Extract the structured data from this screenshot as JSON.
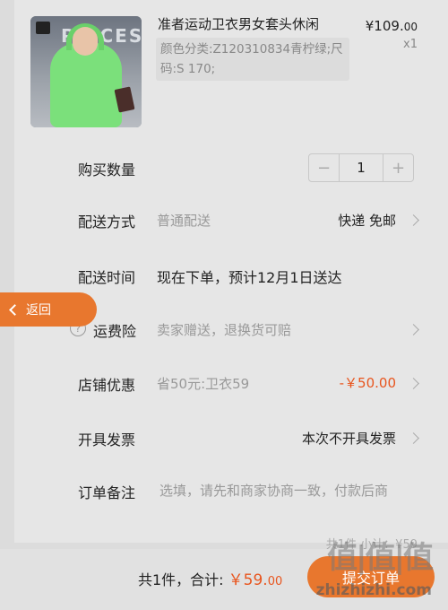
{
  "product": {
    "title": "准者运动卫衣男女套头休闲",
    "variant": "颜色分类:Z120310834青柠绿;尺码:S 170;",
    "price": "¥109.",
    "price_cents": "00",
    "quantity_label": "x1",
    "image_sign_text": "PRICES",
    "image_colors": {
      "hoodie": "#7be07b",
      "background": "#8a8f97"
    }
  },
  "quantity": {
    "label": "购买数量",
    "minus": "−",
    "value": "1",
    "plus": "+"
  },
  "shipping": {
    "label": "配送方式",
    "sub": "普通配送",
    "value": "快递 免邮"
  },
  "delivery_time": {
    "label": "配送时间",
    "value": "现在下单，预计12月1日送达"
  },
  "insurance": {
    "label": "运费险",
    "sub": "卖家赠送，退换货可赔",
    "help_icon": "?"
  },
  "shop_discount": {
    "label": "店铺优惠",
    "sub": "省50元:卫衣59",
    "value": "-￥50.00"
  },
  "invoice": {
    "label": "开具发票",
    "value": "本次不开具发票"
  },
  "note": {
    "label": "订单备注",
    "placeholder": "选填，请先和商家协商一致，付款后商"
  },
  "back_button": {
    "label": "返回"
  },
  "subtotal_ghost": "共1件  小计：¥59",
  "bottom": {
    "count_text": "共1件，合计:",
    "amount": "￥59.",
    "amount_cents": "00",
    "submit_label": "提交订单"
  },
  "watermark": {
    "logo": "值|值|值",
    "site": "zhizhizhi.com"
  },
  "colors": {
    "accent": "#e8772e",
    "price_red": "#e8551e"
  }
}
